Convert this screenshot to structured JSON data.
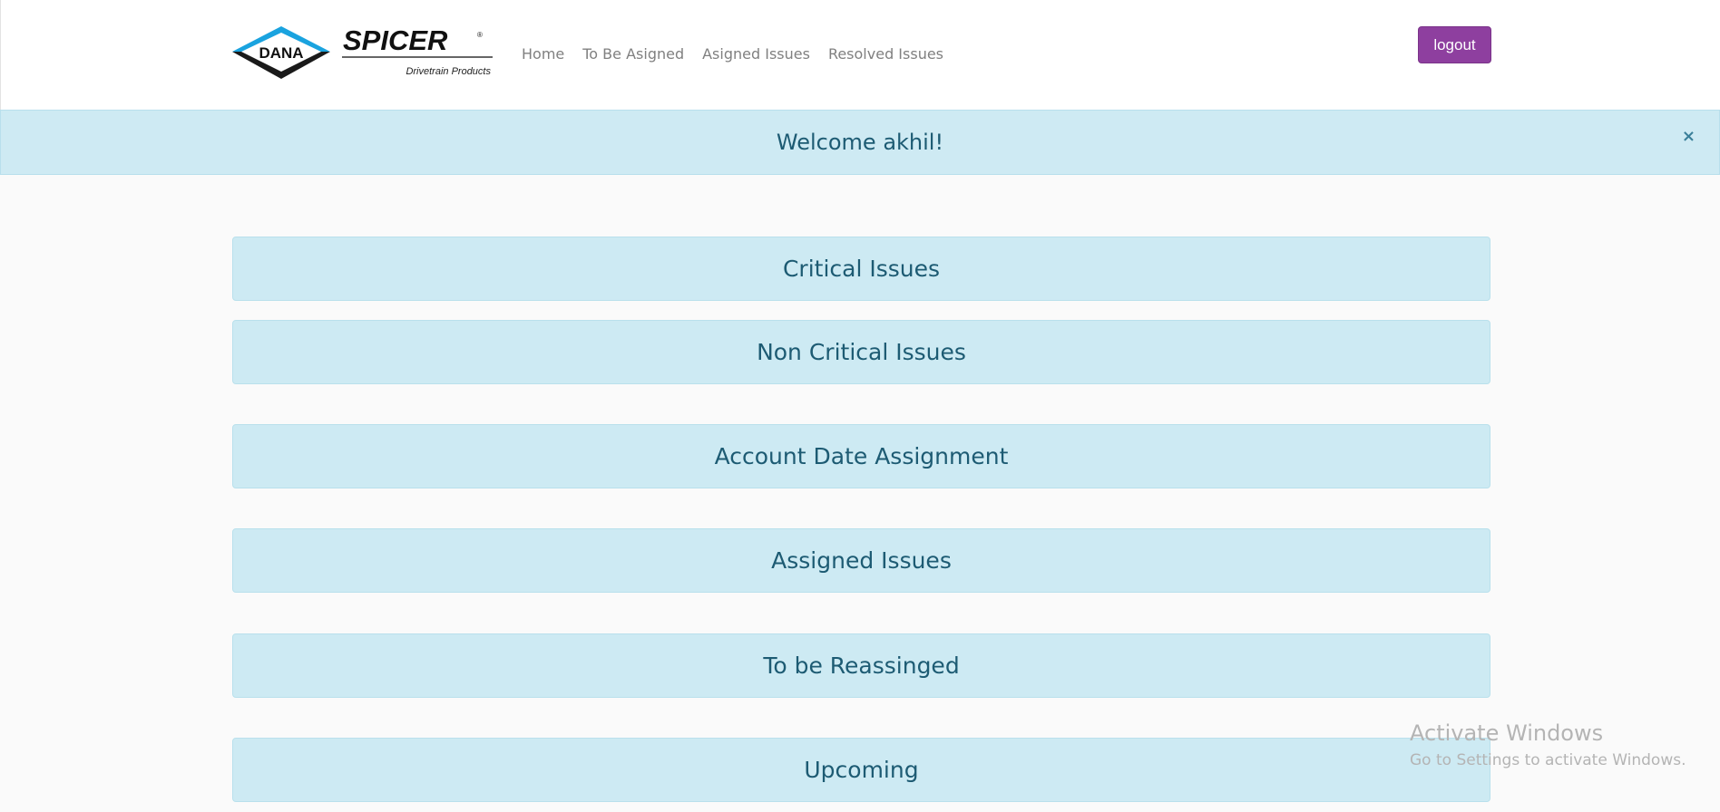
{
  "brand": {
    "logo_left": "DANA",
    "logo_right": "SPICER",
    "logo_tagline": "Drivetrain Products",
    "primary_color": "#8e3f9f",
    "alert_bg": "#ceeaf3",
    "alert_text": "#1d5b73"
  },
  "nav": {
    "items": [
      {
        "label": "Home"
      },
      {
        "label": "To Be Asigned"
      },
      {
        "label": "Asigned Issues"
      },
      {
        "label": "Resolved Issues"
      }
    ],
    "logout_label": "logout"
  },
  "alert": {
    "message": "Welcome akhil!",
    "close_label": "×"
  },
  "panels": [
    {
      "label": "Critical Issues"
    },
    {
      "label": "Non Critical Issues"
    },
    {
      "label": "Account Date Assignment"
    },
    {
      "label": "Assigned Issues"
    },
    {
      "label": "To be Reassinged"
    },
    {
      "label": "Upcoming"
    }
  ],
  "watermark": {
    "title": "Activate Windows",
    "subtitle": "Go to Settings to activate Windows."
  }
}
